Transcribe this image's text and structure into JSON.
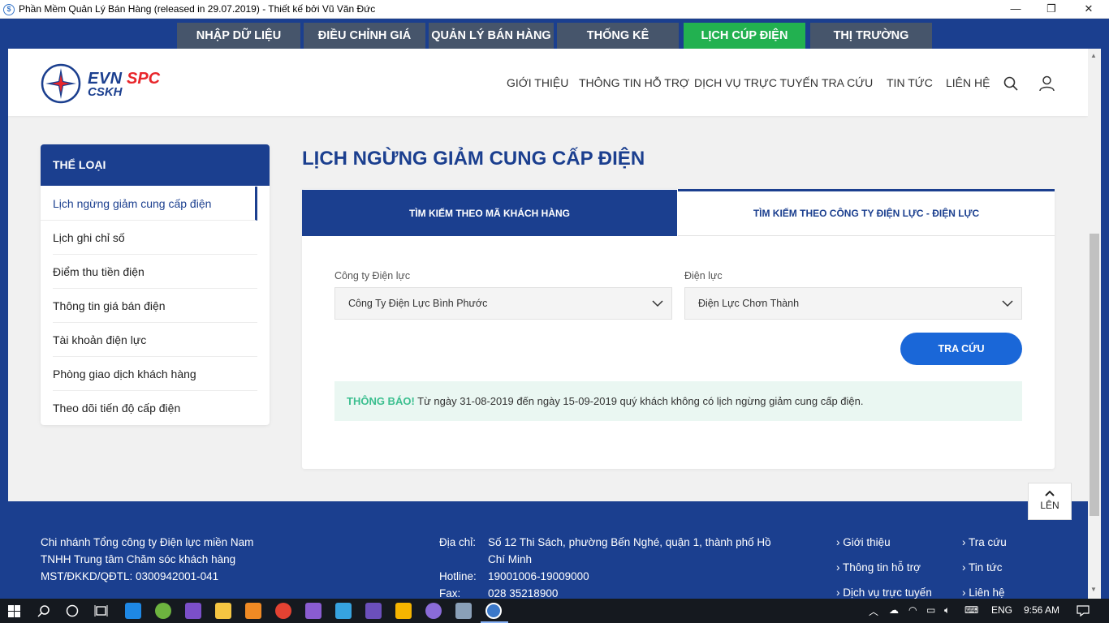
{
  "window": {
    "title": "Phần Mềm Quản Lý Bán Hàng (released in 29.07.2019) - Thiết kế bởi Vũ Văn Đức",
    "minimize": "—",
    "maximize": "❐",
    "close": "✕"
  },
  "top_tabs": [
    {
      "label": "NHẬP DỮ LIỆU"
    },
    {
      "label": "ĐIỀU CHỈNH GIÁ"
    },
    {
      "label": "QUẢN LÝ BÁN HÀNG"
    },
    {
      "label": "THỐNG KÊ"
    },
    {
      "label": "LỊCH CÚP ĐIỆN",
      "active": true
    },
    {
      "label": "THỊ TRƯỜNG"
    }
  ],
  "header": {
    "logo_evn": "EVN",
    "logo_spc": "SPC",
    "logo_cskh": "CSKH",
    "nav": [
      "GIỚI THIỆU",
      "THÔNG TIN HỖ TRỢ",
      "DỊCH VỤ TRỰC TUYẾN",
      "TRA CỨU",
      "TIN TỨC",
      "LIÊN HỆ"
    ]
  },
  "sidebar": {
    "title": "THỂ LOẠI",
    "items": [
      "Lịch ngừng giảm cung cấp điện",
      "Lịch ghi chỉ số",
      "Điểm thu tiền điện",
      "Thông tin giá bán điện",
      "Tài khoản điện lực",
      "Phòng giao dịch khách hàng",
      "Theo dõi tiến độ cấp điện"
    ],
    "active_index": 0
  },
  "main": {
    "title": "LỊCH NGỪNG GIẢM CUNG CẤP ĐIỆN",
    "tabs": [
      "TÌM KIẾM THEO MÃ KHÁCH HÀNG",
      "TÌM KIẾM THEO CÔNG TY ĐIỆN LỰC - ĐIỆN LỰC"
    ],
    "company_label": "Công ty Điện lực",
    "company_value": "Công Ty Điện Lực Bình Phước",
    "branch_label": "Điện lực",
    "branch_value": "Điện Lực Chơn Thành",
    "search_button": "TRA CỨU",
    "notice_label": "THÔNG BÁO!",
    "notice_text": " Từ ngày 31-08-2019 đến ngày 15-09-2019 quý khách không có lịch ngừng giảm cung cấp điện."
  },
  "up_button": "LÊN",
  "footer": {
    "org_lines": [
      "Chi nhánh Tổng công ty Điện lực miền Nam",
      "TNHH Trung tâm Chăm sóc khách hàng",
      "MST/ĐKKD/QĐTL: 0300942001-041"
    ],
    "address_label": "Địa chỉ:",
    "address_value_1": "Số 12 Thi Sách, phường Bến Nghé, quận 1, thành phố Hồ",
    "address_value_2": "Chí Minh",
    "hotline_label": "Hotline:",
    "hotline_value": "19001006-19009000",
    "fax_label": "Fax:",
    "fax_value": "028 35218900",
    "links_col1": [
      "Giới thiệu",
      "Thông tin hỗ trợ",
      "Dịch vụ trực tuyến"
    ],
    "links_col2": [
      "Tra cứu",
      "Tin tức",
      "Liên hệ"
    ]
  },
  "taskbar": {
    "lang": "ENG",
    "time": "9:56 AM"
  }
}
